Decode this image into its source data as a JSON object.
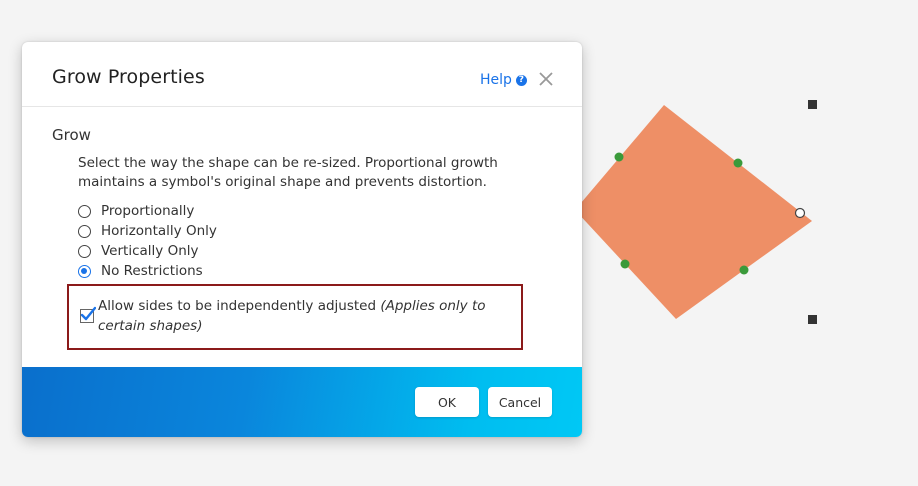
{
  "dialog": {
    "title": "Grow Properties",
    "help_label": "Help",
    "help_icon": "question-circle-icon",
    "close_icon": "close-icon"
  },
  "grow": {
    "section_title": "Grow",
    "description": "Select the way the shape can be re-sized. Proportional growth maintains a symbol's original shape and prevents distortion.",
    "options": [
      {
        "label": "Proportionally",
        "selected": false
      },
      {
        "label": "Horizontally Only",
        "selected": false
      },
      {
        "label": "Vertically Only",
        "selected": false
      },
      {
        "label": "No Restrictions",
        "selected": true
      }
    ],
    "independent_sides": {
      "checked": true,
      "label": "Allow sides to be independently adjusted",
      "note": "(Applies only to certain shapes)"
    }
  },
  "footer": {
    "ok_label": "OK",
    "cancel_label": "Cancel"
  },
  "colors": {
    "shape_fill": "#ee8f66",
    "handle_green": "#3a9a3a",
    "accent_blue": "#1a73e8",
    "highlight_border": "#8b1a1a"
  }
}
